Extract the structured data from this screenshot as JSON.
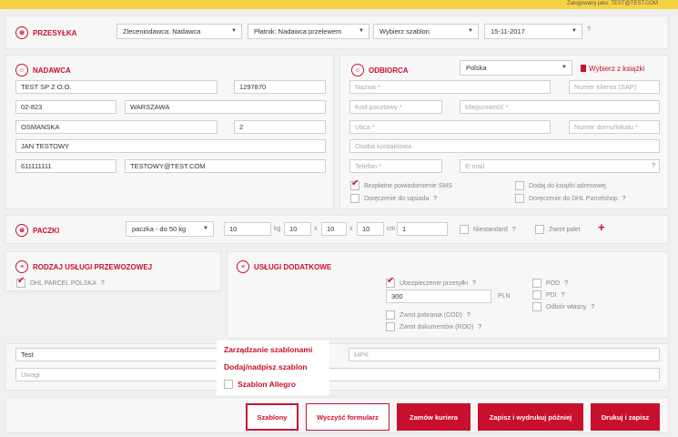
{
  "topbar": {
    "logged_in": "Zalogowany jako: TEST@TEST.COM"
  },
  "shipment": {
    "title": "PRZESYŁKA",
    "payer_order": "Zleceniodawca: Nadawca",
    "payer": "Płatnik: Nadawca przelewem",
    "template": "Wybierz szablon",
    "date": "15-11-2017"
  },
  "sender": {
    "title": "NADAWCA",
    "name": "TEST SP Z O.O.",
    "number": "1297870",
    "postcode": "02-823",
    "city": "WARSZAWA",
    "street": "OSMANSKA",
    "house": "2",
    "contact": "JAN TESTOWY",
    "phone": "611111111",
    "email": "TESTOWY@TEST.COM"
  },
  "receiver": {
    "title": "ODBIORCA",
    "country": "Polska",
    "address_book": "Wybierz z książki",
    "name_ph": "Nazwa *",
    "client_ph": "Numer klienta (SAP)",
    "postcode_ph": "Kod pocztowy *",
    "city_ph": "Miejscowość *",
    "street_ph": "Ulica *",
    "house_ph": "Numer domu/lokalu *",
    "contact_ph": "Osoba kontaktowa",
    "phone_ph": "Telefon *",
    "email_ph": "E-mail",
    "sms": "Bezpłatne powiadomienie SMS",
    "neighbor": "Doręczenie do sąsiada",
    "add_book": "Dodaj do książki adresowej",
    "parcelshop": "Doręczenie do DHL Parcelshop"
  },
  "parcels": {
    "title": "PACZKI",
    "type": "paczka - do 50 kg",
    "weight": "10",
    "weight_unit": "kg",
    "length": "10",
    "width": "10",
    "height": "10",
    "dim_unit": "cm",
    "x_sep": "x",
    "count": "1",
    "nonstandard": "Niestandard",
    "pallet_return": "Zwrot palet",
    "add": "+"
  },
  "service": {
    "title": "RODZAJ USŁUGI PRZEWOZOWEJ",
    "option": "DHL PARCEL POLSKA"
  },
  "extras": {
    "title": "USŁUGI DODATKOWE",
    "insurance": "Ubezpieczenie przesyłki",
    "insurance_value": "300",
    "currency": "PLN",
    "cod": "Zwrot pobrania (COD)",
    "rod": "Zwrot dokumentów (ROD)",
    "pod": "POD",
    "pdi": "PDI",
    "self_pickup": "Odbiór własny"
  },
  "footer_fields": {
    "content": "Test",
    "mpk_ph": "MPK",
    "notes_ph": "Uwagi"
  },
  "templates_menu": {
    "manage": "Zarządzanie szablonami",
    "add": "Dodaj/nadpisz szablon",
    "allegro": "Szablon Allegro"
  },
  "actions": {
    "templates": "Szablony",
    "clear": "Wyczyść formularz",
    "courier": "Zamów kuriera",
    "save_print_later": "Zapisz i wydrukuj później",
    "print_save": "Drukuj i zapisz"
  },
  "icons": {
    "help": "?",
    "arrow": "▼"
  }
}
